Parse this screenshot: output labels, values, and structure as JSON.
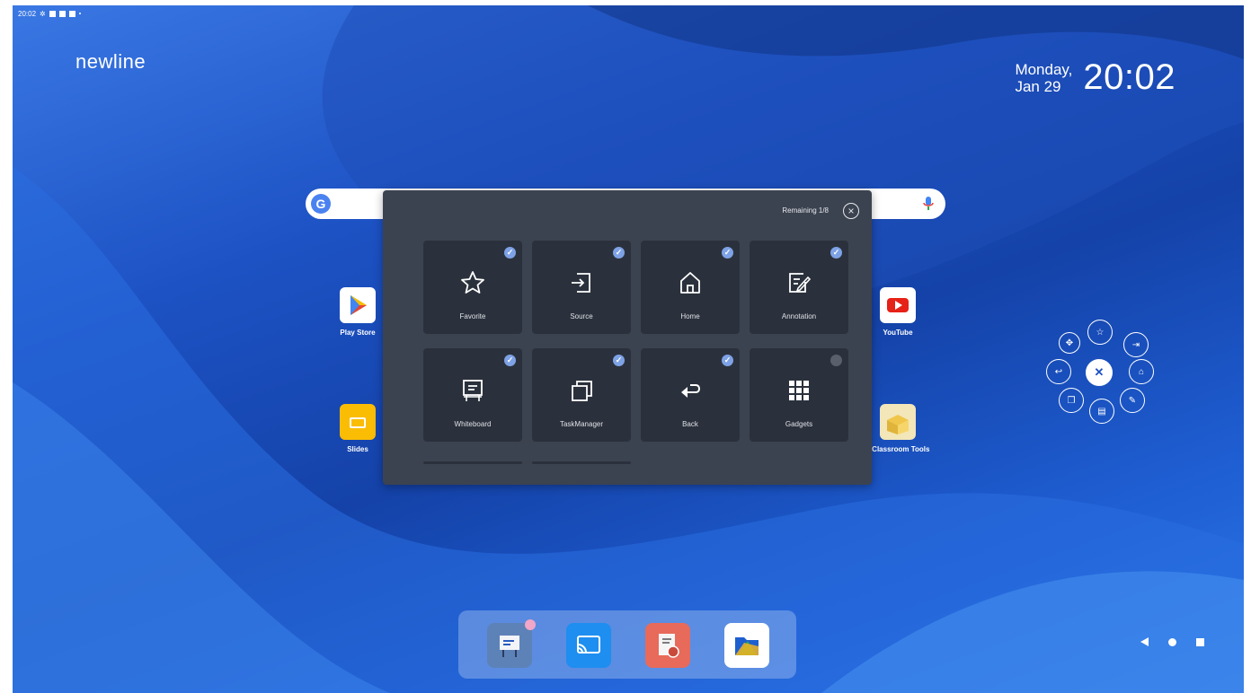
{
  "status_bar": {
    "time": "20:02"
  },
  "brand": "newline",
  "clock": {
    "day": "Monday,",
    "date": "Jan 29",
    "time": "20:02"
  },
  "search": {
    "logo": "G"
  },
  "desktop_apps": [
    {
      "label": "Play Store",
      "icon": "play-store-icon"
    },
    {
      "label": "YouTube",
      "icon": "youtube-icon"
    },
    {
      "label": "Slides",
      "icon": "slides-icon"
    },
    {
      "label": "e Classroom Tools",
      "icon": "classroom-tools-icon"
    }
  ],
  "panel": {
    "remaining": "Remaining 1/8",
    "items": [
      {
        "label": "Favorite",
        "icon": "star-icon",
        "checked": true
      },
      {
        "label": "Source",
        "icon": "source-icon",
        "checked": true
      },
      {
        "label": "Home",
        "icon": "home-icon",
        "checked": true
      },
      {
        "label": "Annotation",
        "icon": "annotation-icon",
        "checked": true
      },
      {
        "label": "Whiteboard",
        "icon": "whiteboard-icon",
        "checked": true
      },
      {
        "label": "TaskManager",
        "icon": "task-manager-icon",
        "checked": true
      },
      {
        "label": "Back",
        "icon": "back-icon",
        "checked": true
      },
      {
        "label": "Gadgets",
        "icon": "gadgets-icon",
        "checked": false
      }
    ]
  },
  "floating_menu": {
    "center": "✕",
    "buttons": [
      "move-icon",
      "star-icon",
      "source-icon",
      "back-icon",
      "home-icon",
      "task-manager-icon",
      "whiteboard-icon",
      "annotation-icon"
    ]
  },
  "dock": [
    "whiteboard-app-icon",
    "screen-cast-icon",
    "note-app-icon",
    "files-app-icon"
  ],
  "nav": [
    "back-icon",
    "home-icon",
    "recents-icon"
  ],
  "colors": {
    "panel_bg": "#3c4350",
    "card_bg": "#2b313c",
    "check": "#7ea2e6",
    "accent_blue": "#1d52c4"
  }
}
